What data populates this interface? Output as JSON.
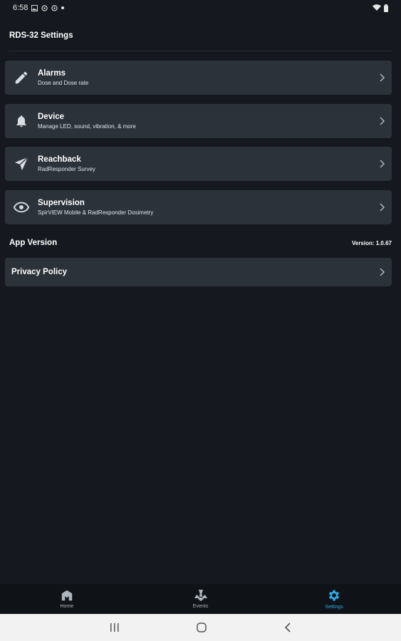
{
  "status_bar": {
    "time": "6:58"
  },
  "page_title": "RDS-32 Settings",
  "settings_items": [
    {
      "label": "Alarms",
      "sub": "Dose and Dose rate",
      "icon": "pencil-icon"
    },
    {
      "label": "Device",
      "sub": "Manage LED, sound, vibration, & more",
      "icon": "bell-icon"
    },
    {
      "label": "Reachback",
      "sub": "RadResponder Survey",
      "icon": "send-icon"
    },
    {
      "label": "Supervision",
      "sub": "SpirVIEW Mobile & RadResponder Dosimetry",
      "icon": "eye-icon"
    }
  ],
  "app_version": {
    "label": "App Version",
    "version": "Version: 1.0.67"
  },
  "privacy": {
    "label": "Privacy Policy"
  },
  "bottom_nav": [
    {
      "label": "Home",
      "icon": "home-icon",
      "active": false
    },
    {
      "label": "Events",
      "icon": "radiation-icon",
      "active": false
    },
    {
      "label": "Settings",
      "icon": "gear-icon",
      "active": true
    }
  ],
  "colors": {
    "accent": "#2fa8e0",
    "card": "#2b323a",
    "background": "#15191f"
  }
}
